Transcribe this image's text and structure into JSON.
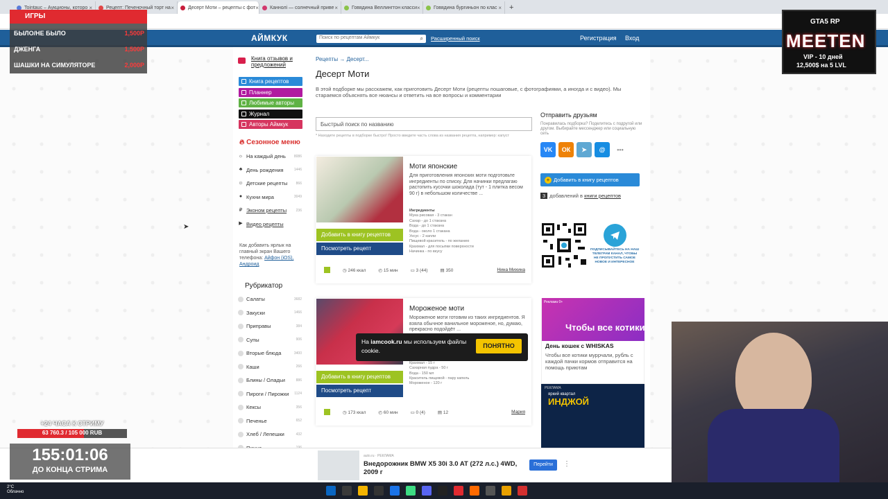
{
  "browser": {
    "tabs": [
      {
        "label": "Tointauc – Аукционы, которо",
        "color": "#5a7bd8",
        "active": false
      },
      {
        "label": "Рецепт: Печеночный торт на",
        "color": "#e04646",
        "active": false
      },
      {
        "label": "Десерт Моти – рецепты с фот",
        "color": "#c81e3c",
        "active": true
      },
      {
        "label": "Каннолі — солнечный приве",
        "color": "#d2386e",
        "active": false
      },
      {
        "label": "Говядина Веллингтон класси",
        "color": "#8bc34a",
        "active": false
      },
      {
        "label": "Говядина бургиньон по клас",
        "color": "#8bc34a",
        "active": false
      }
    ],
    "new_tab": "+"
  },
  "header": {
    "logo": "АЙМКУК",
    "search_placeholder": "Поиск по рецептам Аймкук",
    "advanced_search": "Расширенный поиск",
    "register": "Регистрация",
    "login": "Вход"
  },
  "sidebar": {
    "feedback": "Книга отзывов и предложений",
    "nav": [
      {
        "label": "Книга рецептов",
        "color": "#2a8ad8"
      },
      {
        "label": "Планнер",
        "color": "#b11aa0"
      },
      {
        "label": "Любимые авторы",
        "color": "#5fb244"
      },
      {
        "label": "Журнал",
        "color": "#111111"
      },
      {
        "label": "Авторы Аймкук",
        "color": "#d6355f"
      }
    ],
    "season_title": "Сезонное меню",
    "season_items": [
      {
        "label": "На каждый день",
        "count": "8086",
        "icon": "☼",
        "underline": false
      },
      {
        "label": "День рождения",
        "count": "1446",
        "icon": "♣",
        "underline": false
      },
      {
        "label": "Детские рецепты",
        "count": "866",
        "icon": "☺",
        "underline": false
      },
      {
        "label": "Кухни мира",
        "count": "3049",
        "icon": "●",
        "underline": false
      },
      {
        "label": "Эконом рецепты",
        "count": "236",
        "icon": "₽",
        "underline": true
      },
      {
        "label": "Видео рецепты",
        "count": "",
        "icon": "▶",
        "underline": true
      }
    ],
    "add_hint_prefix": "Как добавить ярлык на главный экран Вашего телефона:",
    "add_hint_links": "Айфон (iOS), Андроид",
    "rubricator_title": "Рубрикатор",
    "rubricator_items": [
      {
        "label": "Салаты",
        "count": "3682"
      },
      {
        "label": "Закуски",
        "count": "1466"
      },
      {
        "label": "Приправы",
        "count": "384"
      },
      {
        "label": "Супы",
        "count": "906"
      },
      {
        "label": "Вторые блюда",
        "count": "3400"
      },
      {
        "label": "Каши",
        "count": "266"
      },
      {
        "label": "Блины / Оладьи",
        "count": "886"
      },
      {
        "label": "Пироги / Пирожки",
        "count": "1124"
      },
      {
        "label": "Кексы",
        "count": "356"
      },
      {
        "label": "Печенье",
        "count": "652"
      },
      {
        "label": "Хлеб / Лепешки",
        "count": "432"
      },
      {
        "label": "Пицца",
        "count": "196"
      }
    ]
  },
  "main": {
    "breadcrumb": "Рецепты → Десерт...",
    "title": "Десерт Моти",
    "intro": "В этой подборке мы расскажем, как приготовить Десерт Моти (рецепты пошаговые, с фотографиями, а иногда и с видео). Мы стараемся объяснять все нюансы и ответить на все вопросы и комментарии",
    "quick_search_placeholder": "Быстрый поиск по названию",
    "quick_search_note": "* Находите рецепты в подборке быстро! Просто введите часть слова из названия рецепта, например: капуст",
    "add_label": "Добавить в книгу рецептов",
    "view_label": "Посмотреть рецепт",
    "ingredients_label": "Ингредиенты",
    "recipes": [
      {
        "title": "Моти японские",
        "desc": "Для приготовления японских моти подготовьте ингредиенты по списку. Для начинки предлагаю растопить кусочки шоколада (тут - 1 плитка весом 90 г) в небольшом количестве ...",
        "ingredients": [
          "Мука рисовая - 3 стакан",
          "Сахар - до 1 стакана",
          "Вода - до 1 стакана",
          "Вода - около 1 стакана",
          "Уксус - 2 капли",
          "Пищевой краситель - по желанию",
          "Крахмал - для посыпки поверхности",
          "Начинка - по вкусу"
        ],
        "kcal": "246 ккал",
        "time": "15 мин",
        "comments": "3 (44)",
        "saves": "350",
        "author": "Нина Михина"
      },
      {
        "title": "Мороженое моти",
        "desc": "Мороженое моти готовим из таких ингредиентов. Я взяла обычное ванильное мороженое, но, думаю, прекрасно подойдёт ...",
        "ingredients": [
          "Рисовая мука - 100 г",
          "Крахмал - 15 г",
          "Сахарная пудра - 50 г",
          "Вода - 150 мл",
          "Краситель пищевой - пару капель",
          "Мороженое - 120 г"
        ],
        "kcal": "173 ккал",
        "time": "60 мин",
        "comments": "0 (4)",
        "saves": "12",
        "author": "Мария"
      }
    ]
  },
  "right": {
    "share_title": "Отправить друзьям",
    "share_sub": "Понравилась подборка? Поделитесь с подругой или другом. Выбирайте мессенджер или социальную сеть",
    "social": [
      {
        "name": "vk",
        "label": "VK",
        "color": "#2787f5"
      },
      {
        "name": "ok",
        "label": "ОК",
        "color": "#ee8208"
      },
      {
        "name": "telegram",
        "label": "➤",
        "color": "#5fa8d3"
      },
      {
        "name": "mail",
        "label": "@",
        "color": "#168de2"
      },
      {
        "name": "more",
        "label": "•••",
        "color": "#ffffff"
      }
    ],
    "add_book": "Добавить в книгу рецептов",
    "added_count": "3",
    "added_text": "добавлений в",
    "added_link": "книги рецептов",
    "tg_text": "ПОДПИСЫВАЙТЕСЬ НА НАШ ТЕЛЕГРАМ КАНАЛ, ЧТОБЫ НЕ ПРОПУСТИТЬ САМОЕ НОВОЕ И ИНТЕРЕСНОЕ",
    "ad1_badge": "Реклама 0+",
    "ad1_img_text": "Чтобы все котики",
    "ad1_title": "День кошек с WHISKAS",
    "ad1_desc": "Чтобы все котики муррчали, рубль с каждой пачки кормов отправится на помощь приютам",
    "ad2_badge": "РЕКЛАМА",
    "ad2_sub": "яркий квартал",
    "ad2_title": "ИНДЖОЙ"
  },
  "overlays": {
    "games_title": "ИГРЫ",
    "games": [
      {
        "name": "БЫЛО/НЕ БЫЛО",
        "price": "1,500Р"
      },
      {
        "name": "ДЖЕНГА",
        "price": "1,500Р"
      },
      {
        "name": "ШАШКИ НА СИМУЛЯТОРЕ",
        "price": "2,000Р"
      }
    ],
    "gtas_brand": "GTA5 RP",
    "gtas_title": "MEETEN",
    "gtas_line1": "VIP - 10 дней",
    "gtas_line2": "12,500$ на 5 LVL",
    "cookie_prefix": "На",
    "cookie_site": "iamcook.ru",
    "cookie_text": "мы используем файлы cookie.",
    "cookie_button": "ПОНЯТНО",
    "stream_goal": "+24 ЧАСА К СТРИМУ",
    "goal_text": "63 760.3 / 105 000 RUB",
    "goal_progress": 0.607,
    "timer": "155:01:06",
    "timer_label": "ДО КОНЦА СТРИМА"
  },
  "bottom_ad": {
    "source": "auto.ru · РЕКЛАМА",
    "title": "Внедорожник BMW X5 30i 3.0 AT (272 л.с.) 4WD, 2009 г",
    "button": "Перейти"
  },
  "taskbar": {
    "temp": "2°C",
    "weather": "Облачно"
  }
}
